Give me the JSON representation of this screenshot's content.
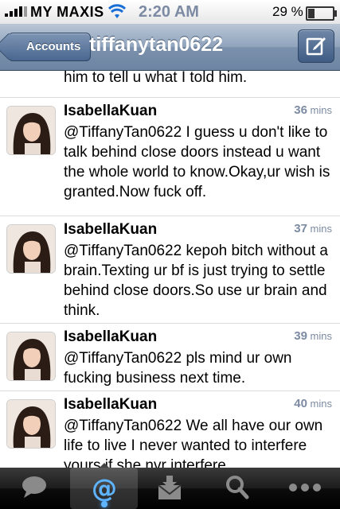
{
  "status_bar": {
    "carrier": "MY MAXIS",
    "time": "2:20 AM",
    "battery": "29 %",
    "battery_level": 0.29
  },
  "nav": {
    "back_label": "Accounts",
    "title": "tiffanytan0622",
    "compose_icon": "compose-icon"
  },
  "timeline": {
    "partial_text": "him to tell u what I told him.",
    "tweets": [
      {
        "user": "IsabellaKuan",
        "time_num": "36",
        "time_unit": " mins",
        "text": "@TiffanyTan0622 I guess u don't like to talk behind close doors instead u want the whole world to know.Okay,ur wish is granted.Now fuck off."
      },
      {
        "user": "IsabellaKuan",
        "time_num": "37",
        "time_unit": " mins",
        "text": "@TiffanyTan0622 kepoh bitch without a brain.Texting ur bf is just trying to settle behind close doors.So use ur brain and think."
      },
      {
        "user": "IsabellaKuan",
        "time_num": "39",
        "time_unit": " mins",
        "text": "@TiffanyTan0622 pls mind ur own fucking business next time."
      },
      {
        "user": "IsabellaKuan",
        "time_num": "40",
        "time_unit": " mins",
        "text": "@TiffanyTan0622 We all have our own life to live I never wanted to interfere yours if she nvr interfere"
      }
    ]
  },
  "tab_bar": {
    "tabs": [
      {
        "icon": "speech-bubble-icon"
      },
      {
        "icon": "at-sign-icon",
        "selected": true
      },
      {
        "icon": "envelope-icon"
      },
      {
        "icon": "search-icon"
      },
      {
        "icon": "more-dots-icon"
      }
    ]
  },
  "colors": {
    "nav_blue": "#6d85a3",
    "timestamp": "#7c8ba3",
    "selected_tab_glow": "#5fb4ff"
  }
}
